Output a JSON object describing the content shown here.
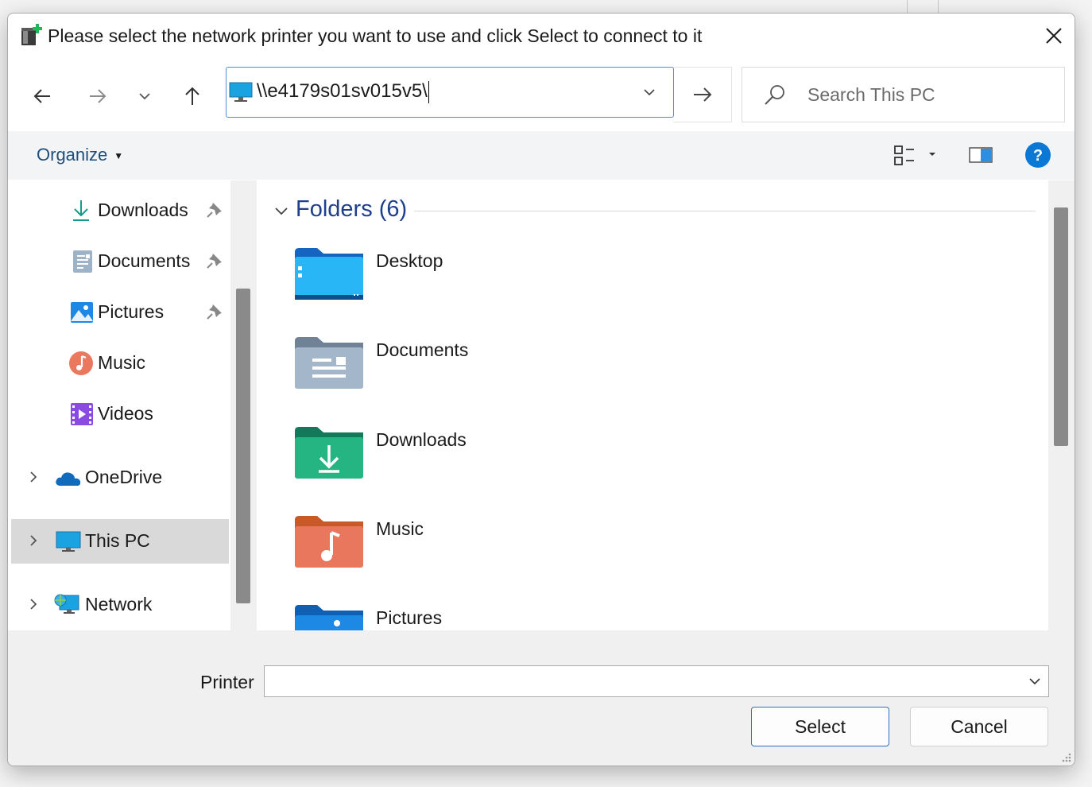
{
  "window": {
    "title": "Please select the network printer you want to use and click Select to connect to it"
  },
  "navigation": {
    "address_value": "\\\\e4179s01sv015v5\\",
    "search_placeholder": "Search This PC"
  },
  "toolbar": {
    "organize_label": "Organize"
  },
  "nav_pane": {
    "quick_access": [
      {
        "label": "Downloads",
        "icon": "download-arrow-icon",
        "pinned": true
      },
      {
        "label": "Documents",
        "icon": "document-icon",
        "pinned": true
      },
      {
        "label": "Pictures",
        "icon": "pictures-icon",
        "pinned": true
      },
      {
        "label": "Music",
        "icon": "music-icon",
        "pinned": false
      },
      {
        "label": "Videos",
        "icon": "videos-icon",
        "pinned": false
      }
    ],
    "roots": [
      {
        "label": "OneDrive",
        "icon": "onedrive-cloud-icon",
        "selected": false
      },
      {
        "label": "This PC",
        "icon": "monitor-icon",
        "selected": true
      },
      {
        "label": "Network",
        "icon": "network-icon",
        "selected": false
      }
    ]
  },
  "content": {
    "group_title": "Folders (6)",
    "folders": [
      {
        "label": "Desktop",
        "icon": "desktop-folder-icon"
      },
      {
        "label": "Documents",
        "icon": "documents-folder-icon"
      },
      {
        "label": "Downloads",
        "icon": "downloads-folder-icon"
      },
      {
        "label": "Music",
        "icon": "music-folder-icon"
      },
      {
        "label": "Pictures",
        "icon": "pictures-folder-icon"
      }
    ]
  },
  "footer": {
    "printer_label": "Printer",
    "printer_value": "",
    "select_label": "Select",
    "cancel_label": "Cancel"
  },
  "colors": {
    "accent": "#0067c0",
    "link_blue": "#1f3f8c",
    "selection": "#d9d9d9"
  }
}
